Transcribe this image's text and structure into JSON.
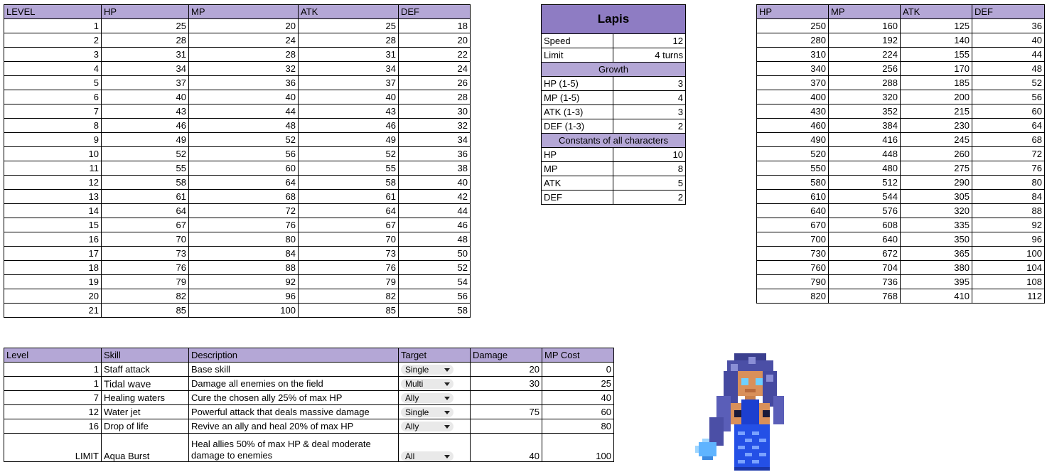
{
  "level_table": {
    "headers": [
      "LEVEL",
      "HP",
      "MP",
      "ATK",
      "DEF"
    ],
    "rows": [
      [
        1,
        25,
        20,
        25,
        18
      ],
      [
        2,
        28,
        24,
        28,
        20
      ],
      [
        3,
        31,
        28,
        31,
        22
      ],
      [
        4,
        34,
        32,
        34,
        24
      ],
      [
        5,
        37,
        36,
        37,
        26
      ],
      [
        6,
        40,
        40,
        40,
        28
      ],
      [
        7,
        43,
        44,
        43,
        30
      ],
      [
        8,
        46,
        48,
        46,
        32
      ],
      [
        9,
        49,
        52,
        49,
        34
      ],
      [
        10,
        52,
        56,
        52,
        36
      ],
      [
        11,
        55,
        60,
        55,
        38
      ],
      [
        12,
        58,
        64,
        58,
        40
      ],
      [
        13,
        61,
        68,
        61,
        42
      ],
      [
        14,
        64,
        72,
        64,
        44
      ],
      [
        15,
        67,
        76,
        67,
        46
      ],
      [
        16,
        70,
        80,
        70,
        48
      ],
      [
        17,
        73,
        84,
        73,
        50
      ],
      [
        18,
        76,
        88,
        76,
        52
      ],
      [
        19,
        79,
        92,
        79,
        54
      ],
      [
        20,
        82,
        96,
        82,
        56
      ],
      [
        21,
        85,
        100,
        85,
        58
      ]
    ]
  },
  "character": {
    "name": "Lapis",
    "speed_label": "Speed",
    "speed_value": "12",
    "limit_label": "Limit",
    "limit_value": "4 turns",
    "growth_title": "Growth",
    "growth": [
      {
        "label": "HP (1-5)",
        "value": "3"
      },
      {
        "label": "MP (1-5)",
        "value": "4"
      },
      {
        "label": "ATK (1-3)",
        "value": "3"
      },
      {
        "label": "DEF (1-3)",
        "value": "2"
      }
    ],
    "constants_title": "Constants of all characters",
    "constants": [
      {
        "label": "HP",
        "value": "10"
      },
      {
        "label": "MP",
        "value": "8"
      },
      {
        "label": "ATK",
        "value": "5"
      },
      {
        "label": "DEF",
        "value": "2"
      }
    ]
  },
  "scaled_table": {
    "headers": [
      "HP",
      "MP",
      "ATK",
      "DEF"
    ],
    "rows": [
      [
        250,
        160,
        125,
        36
      ],
      [
        280,
        192,
        140,
        40
      ],
      [
        310,
        224,
        155,
        44
      ],
      [
        340,
        256,
        170,
        48
      ],
      [
        370,
        288,
        185,
        52
      ],
      [
        400,
        320,
        200,
        56
      ],
      [
        430,
        352,
        215,
        60
      ],
      [
        460,
        384,
        230,
        64
      ],
      [
        490,
        416,
        245,
        68
      ],
      [
        520,
        448,
        260,
        72
      ],
      [
        550,
        480,
        275,
        76
      ],
      [
        580,
        512,
        290,
        80
      ],
      [
        610,
        544,
        305,
        84
      ],
      [
        640,
        576,
        320,
        88
      ],
      [
        670,
        608,
        335,
        92
      ],
      [
        700,
        640,
        350,
        96
      ],
      [
        730,
        672,
        365,
        100
      ],
      [
        760,
        704,
        380,
        104
      ],
      [
        790,
        736,
        395,
        108
      ],
      [
        820,
        768,
        410,
        112
      ]
    ]
  },
  "skills_table": {
    "headers": [
      "Level",
      "Skill",
      "Description",
      "Target",
      "Damage",
      "MP Cost"
    ],
    "rows": [
      {
        "level": "1",
        "skill": "Staff attack",
        "description": "Base skill",
        "target": "Single",
        "damage": "20",
        "mp": "0"
      },
      {
        "level": "1",
        "skill": "Tidal wave",
        "description": "Damage all enemies on the field",
        "target": "Multi",
        "damage": "30",
        "mp": "25"
      },
      {
        "level": "7",
        "skill": "Healing waters",
        "description": "Cure the chosen ally 25% of max HP",
        "target": "Ally",
        "damage": "",
        "mp": "40"
      },
      {
        "level": "12",
        "skill": "Water jet",
        "description": "Powerful attack that deals massive damage",
        "target": "Single",
        "damage": "75",
        "mp": "60"
      },
      {
        "level": "16",
        "skill": "Drop of life",
        "description": "Revive an ally and heal 20% of max HP",
        "target": "Ally",
        "damage": "",
        "mp": "80"
      },
      {
        "level": "LIMIT",
        "skill": "Aqua Burst",
        "description": "Heal allies 50% of max HP & deal moderate damage to enemies",
        "target": "All",
        "damage": "40",
        "mp": "100"
      }
    ]
  },
  "colors": {
    "header_bg": "#b4a7d6",
    "title_bg": "#8e7cc3",
    "dropdown_bg": "#e9e9e9"
  },
  "icons": {
    "dropdown": "chevron-down-icon",
    "sprite": "character-sprite-icon"
  }
}
